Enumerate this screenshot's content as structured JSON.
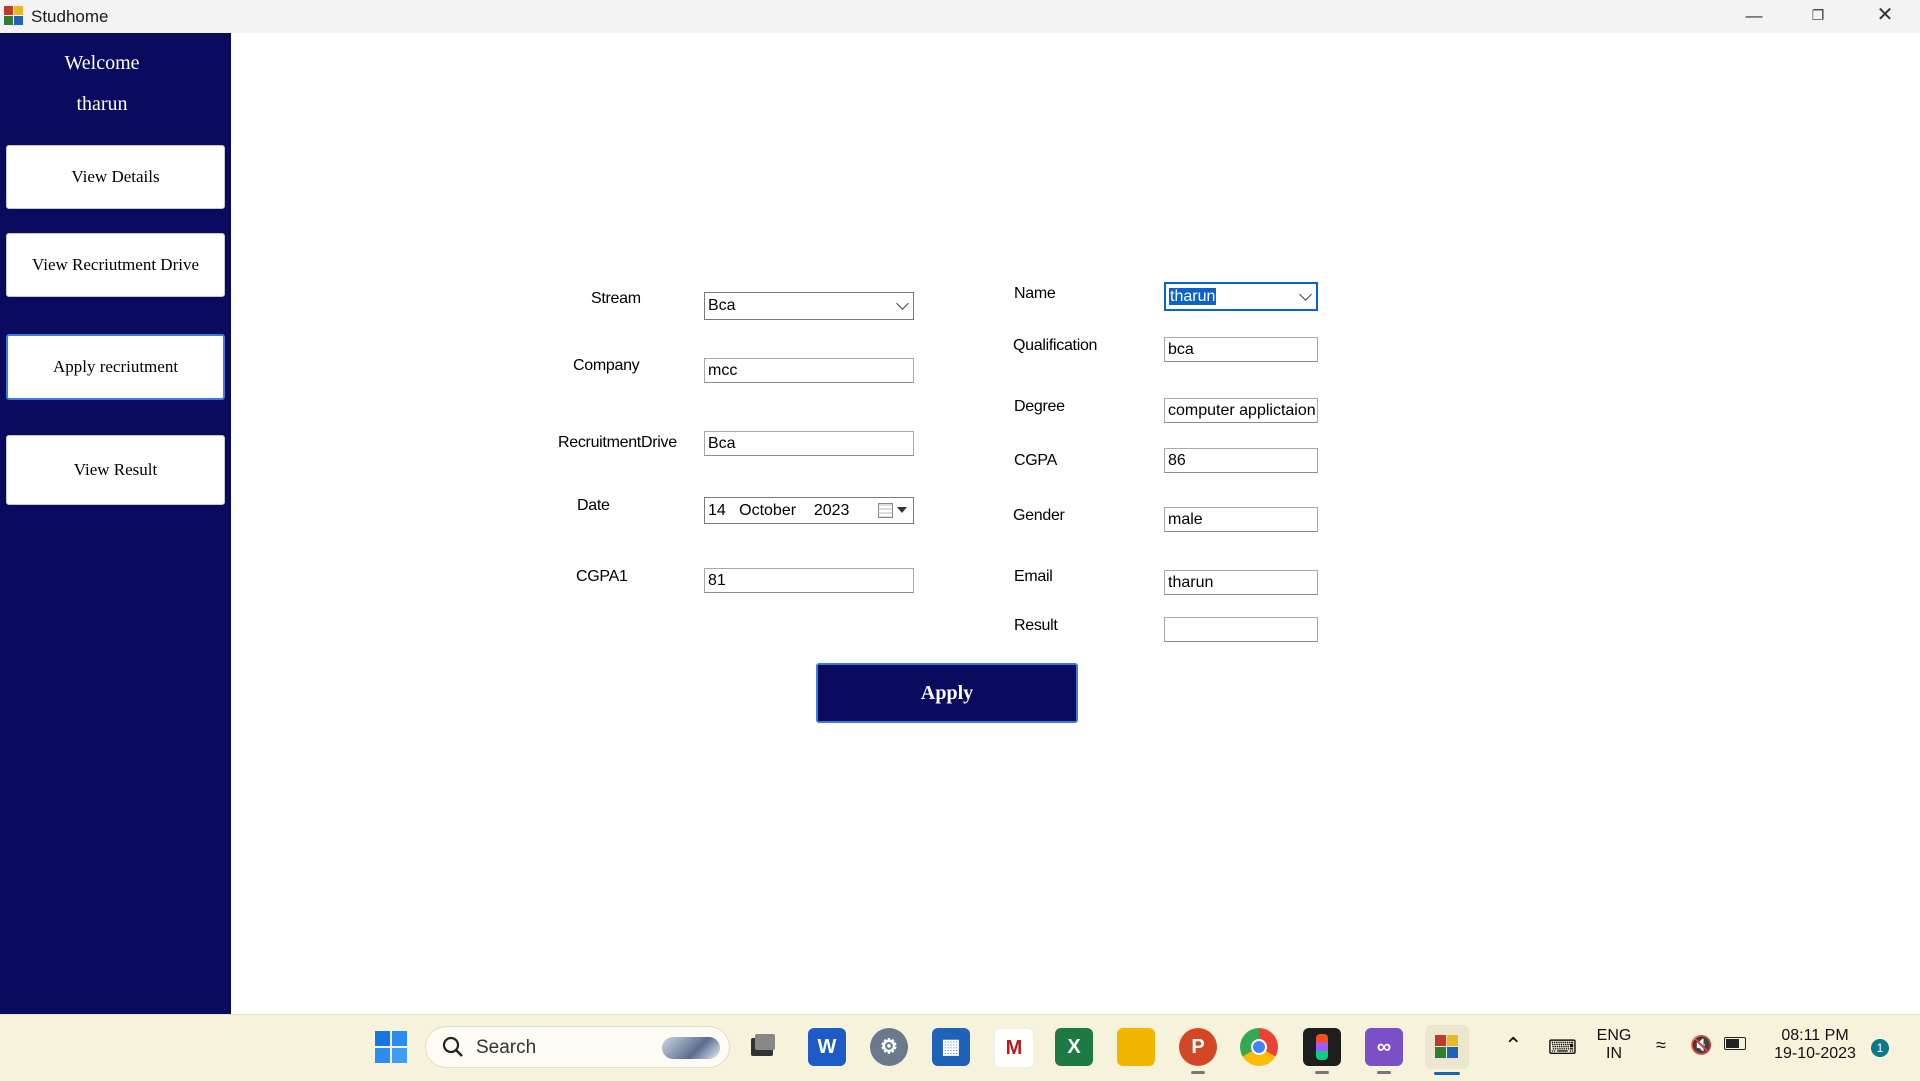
{
  "window": {
    "title": "Studhome",
    "controls": [
      "minimize",
      "restore",
      "close"
    ]
  },
  "sidebar": {
    "welcome": "Welcome",
    "username": "tharun",
    "items": [
      {
        "label": "View Details"
      },
      {
        "label": "View Recriutment Drive"
      },
      {
        "label": "Apply recriutment",
        "active": true
      },
      {
        "label": "View Result"
      }
    ]
  },
  "form": {
    "stream": {
      "label": "Stream",
      "value": "Bca"
    },
    "company": {
      "label": "Company",
      "value": "mcc"
    },
    "recruitment_drive": {
      "label": "RecruitmentDrive",
      "value": "Bca"
    },
    "date": {
      "label": "Date",
      "day": "14",
      "month": "October",
      "year": "2023"
    },
    "cgpa1": {
      "label": "CGPA1",
      "value": "81"
    },
    "name": {
      "label": "Name",
      "value": "tharun"
    },
    "qualification": {
      "label": "Qualification",
      "value": "bca"
    },
    "degree": {
      "label": "Degree",
      "value": "computer applictaion"
    },
    "cgpa": {
      "label": "CGPA",
      "value": "86"
    },
    "gender": {
      "label": "Gender",
      "value": "male"
    },
    "email": {
      "label": "Email",
      "value": "tharun"
    },
    "result": {
      "label": "Result",
      "value": ""
    },
    "apply_label": "Apply"
  },
  "taskbar": {
    "search_placeholder": "Search",
    "apps": [
      "windows-start",
      "task-view",
      "word",
      "settings",
      "microsoft-store",
      "mcafee",
      "excel",
      "file-explorer",
      "powerpoint",
      "chrome",
      "figma",
      "visual-studio",
      "studhome"
    ],
    "language_line1": "ENG",
    "language_line2": "IN",
    "time": "08:11 PM",
    "date": "19-10-2023",
    "notification_count": "1"
  },
  "colors": {
    "sidebar_bg": "#0a0a5e",
    "accent": "#3d7bd8",
    "taskbar_bg": "#f7f2dc"
  }
}
